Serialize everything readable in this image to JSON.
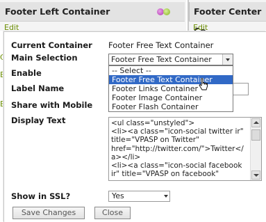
{
  "background": {
    "left_panel_title": "Footer Left Container",
    "right_panel_title": "Footer Center Co",
    "left_edit_label": "Edit",
    "right_edit_label": "Edit",
    "peek_letters": [
      "C",
      "B",
      "E"
    ]
  },
  "form": {
    "current_container": {
      "label": "Current Container",
      "value": "Footer Free Text Container"
    },
    "main_selection": {
      "label": "Main Selection",
      "selected": "Footer Free Text Container",
      "options": [
        "-- Select --",
        "Footer Free Text Container",
        "Footer Links Container",
        "Footer Image Container",
        "Footer Flash Container"
      ],
      "highlighted_index": 1
    },
    "enable": {
      "label": "Enable"
    },
    "label_name": {
      "label": "Label Name",
      "value": ""
    },
    "share_with_mobile": {
      "label": "Share with Mobile"
    },
    "display_text": {
      "label": "Display Text",
      "value": "<ul class=\"unstyled\">\n<li><a class=\"icon-social twitter ir\" title=\"VPASP on Twitter\" href=\"http://twitter.com/\">Twitter</a></li>\n<li><a class=\"icon-social facebook ir\" title=\"VPASP on facebook\""
    },
    "show_in_ssl": {
      "label": "Show in SSL?",
      "value": "Yes"
    },
    "buttons": {
      "save": "Save Changes",
      "close": "Close"
    }
  },
  "colors": {
    "edit_link": "#6a8d00",
    "highlight": "#3169c6"
  }
}
